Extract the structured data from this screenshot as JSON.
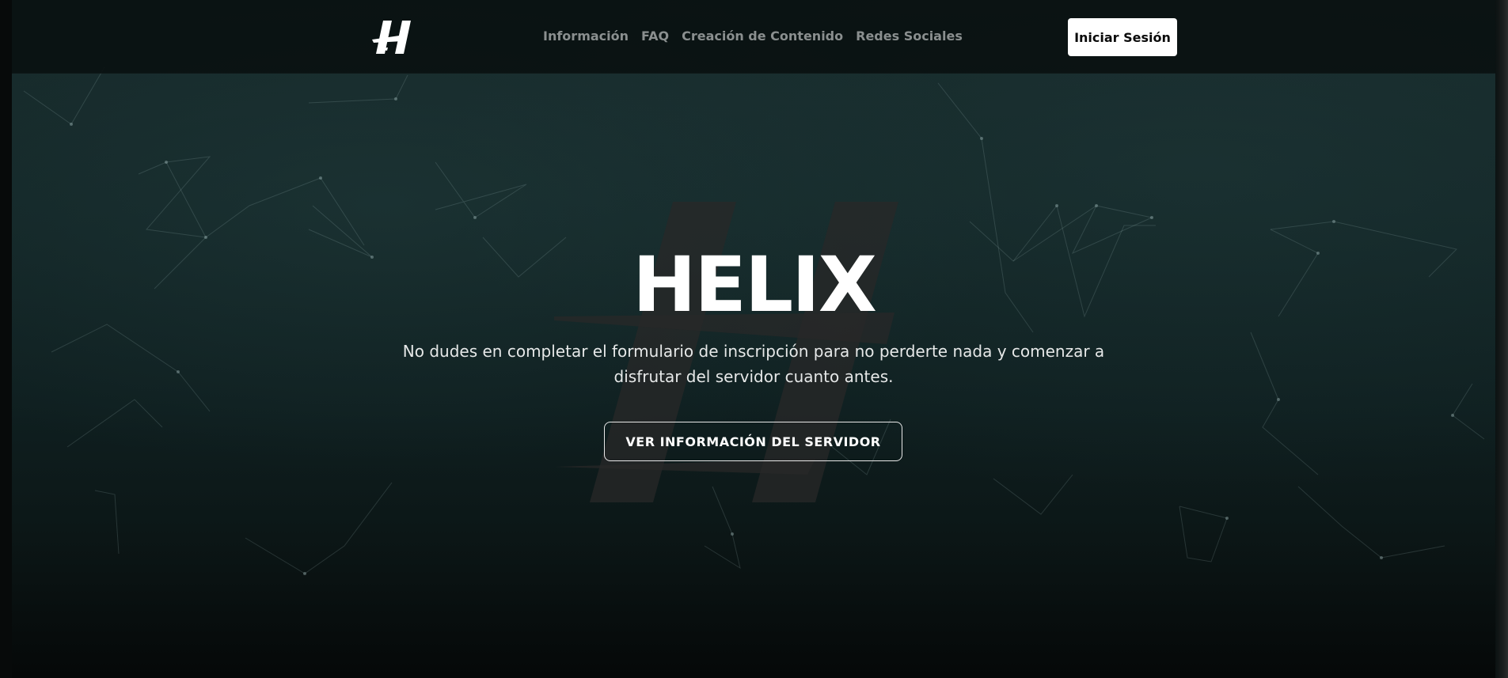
{
  "brand": {
    "logo_icon": "helix-h-logo-icon"
  },
  "nav": {
    "items": [
      {
        "label": "Información"
      },
      {
        "label": "FAQ"
      },
      {
        "label": "Creación de Contenido"
      },
      {
        "label": "Redes Sociales"
      }
    ],
    "login_label": "Iniciar Sesión"
  },
  "hero": {
    "title": "HELIX",
    "subtitle": "No dudes en completar el formulario de inscripción para no perderte nada y comenzar a disfrutar del servidor cuanto antes.",
    "cta_label": "VER INFORMACIÓN DEL SERVIDOR",
    "watermark_icon": "helix-h-watermark-icon"
  },
  "colors": {
    "background": "#0f1f20",
    "nav_link": "#8a8f8f",
    "button_bg": "#ffffff",
    "text": "#ffffff"
  }
}
